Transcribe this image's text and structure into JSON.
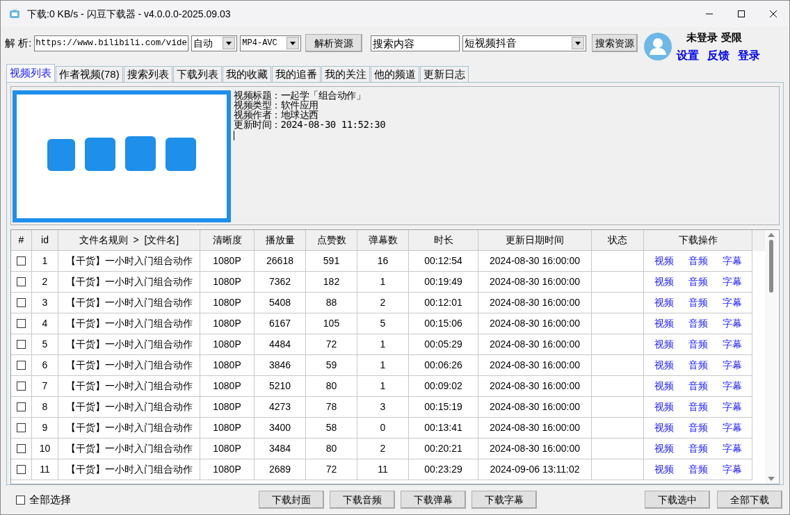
{
  "window": {
    "title": "下载:0 KB/s - 闪豆下载器 - v4.0.0.0-2025.09.03"
  },
  "toolbar": {
    "parse_label": "解 析:",
    "url": "https://www.bilibili.com/vide",
    "quality": "自动",
    "format": "MP4-AVC",
    "parse_button": "解析资源",
    "search_value": "搜索内容",
    "platform": "短视频抖音",
    "search_button": "搜索资源"
  },
  "account": {
    "status": "未登录 受限",
    "links": [
      "设置",
      "反馈",
      "登录"
    ]
  },
  "tabs": [
    {
      "label": "视频列表",
      "selected": true
    },
    {
      "label": "作者视频(78)",
      "selected": false
    },
    {
      "label": "搜索列表",
      "selected": false
    },
    {
      "label": "下载列表",
      "selected": false
    },
    {
      "label": "我的收藏",
      "selected": false
    },
    {
      "label": "我的追番",
      "selected": false
    },
    {
      "label": "我的关注",
      "selected": false
    },
    {
      "label": "他的频道",
      "selected": false
    },
    {
      "label": "更新日志",
      "selected": false
    }
  ],
  "info": {
    "lines": [
      "视频标题：一起学「组合动作」",
      "视频类型：软件应用",
      "视频作者：地球达西",
      "更新时间：2024-08-30 11:52:30"
    ]
  },
  "table": {
    "columns": [
      "#",
      "id",
      "文件名规则  >  [文件名]",
      "清晰度",
      "播放量",
      "点赞数",
      "弹幕数",
      "时长",
      "更新日期时间",
      "状态",
      "下载操作"
    ],
    "rows": [
      {
        "checked": false,
        "id": "1",
        "name": "【干货】一小时入门组合动作",
        "quality": "1080P",
        "plays": "26618",
        "likes": "591",
        "danmaku": "16",
        "duration": "00:12:54",
        "updated": "2024-08-30 16:00:00",
        "actions": [
          "视频",
          "音频",
          "字幕"
        ]
      },
      {
        "checked": false,
        "id": "2",
        "name": "【干货】一小时入门组合动作",
        "quality": "1080P",
        "plays": "7362",
        "likes": "182",
        "danmaku": "1",
        "duration": "00:19:49",
        "updated": "2024-08-30 16:00:00",
        "actions": [
          "视频",
          "音频",
          "字幕"
        ]
      },
      {
        "checked": false,
        "id": "3",
        "name": "【干货】一小时入门组合动作",
        "quality": "1080P",
        "plays": "5408",
        "likes": "88",
        "danmaku": "2",
        "duration": "00:12:01",
        "updated": "2024-08-30 16:00:00",
        "actions": [
          "视频",
          "音频",
          "字幕"
        ]
      },
      {
        "checked": false,
        "id": "4",
        "name": "【干货】一小时入门组合动作",
        "quality": "1080P",
        "plays": "6167",
        "likes": "105",
        "danmaku": "5",
        "duration": "00:15:06",
        "updated": "2024-08-30 16:00:00",
        "actions": [
          "视频",
          "音频",
          "字幕"
        ]
      },
      {
        "checked": false,
        "id": "5",
        "name": "【干货】一小时入门组合动作",
        "quality": "1080P",
        "plays": "4484",
        "likes": "72",
        "danmaku": "1",
        "duration": "00:05:29",
        "updated": "2024-08-30 16:00:00",
        "actions": [
          "视频",
          "音频",
          "字幕"
        ]
      },
      {
        "checked": false,
        "id": "6",
        "name": "【干货】一小时入门组合动作",
        "quality": "1080P",
        "plays": "3846",
        "likes": "59",
        "danmaku": "1",
        "duration": "00:06:26",
        "updated": "2024-08-30 16:00:00",
        "actions": [
          "视频",
          "音频",
          "字幕"
        ]
      },
      {
        "checked": false,
        "id": "7",
        "name": "【干货】一小时入门组合动作",
        "quality": "1080P",
        "plays": "5210",
        "likes": "80",
        "danmaku": "1",
        "duration": "00:09:02",
        "updated": "2024-08-30 16:00:00",
        "actions": [
          "视频",
          "音频",
          "字幕"
        ]
      },
      {
        "checked": false,
        "id": "8",
        "name": "【干货】一小时入门组合动作",
        "quality": "1080P",
        "plays": "4273",
        "likes": "78",
        "danmaku": "3",
        "duration": "00:15:19",
        "updated": "2024-08-30 16:00:00",
        "actions": [
          "视频",
          "音频",
          "字幕"
        ]
      },
      {
        "checked": false,
        "id": "9",
        "name": "【干货】一小时入门组合动作",
        "quality": "1080P",
        "plays": "3400",
        "likes": "58",
        "danmaku": "0",
        "duration": "00:13:41",
        "updated": "2024-08-30 16:00:00",
        "actions": [
          "视频",
          "音频",
          "字幕"
        ]
      },
      {
        "checked": false,
        "id": "10",
        "name": "【干货】一小时入门组合动作",
        "quality": "1080P",
        "plays": "3484",
        "likes": "80",
        "danmaku": "2",
        "duration": "00:20:21",
        "updated": "2024-08-30 16:00:00",
        "actions": [
          "视频",
          "音频",
          "字幕"
        ]
      },
      {
        "checked": false,
        "id": "11",
        "name": "【干货】一小时入门组合动作",
        "quality": "1080P",
        "plays": "2689",
        "likes": "72",
        "danmaku": "11",
        "duration": "00:23:29",
        "updated": "2024-09-06 13:11:02",
        "actions": [
          "视频",
          "音频",
          "字幕"
        ]
      }
    ]
  },
  "footer": {
    "select_all": {
      "label": "全部选择",
      "checked": false
    },
    "left_buttons": [
      "下载封面",
      "下载音频",
      "下载弹幕",
      "下载字幕"
    ],
    "right_buttons": [
      "下载选中",
      "全部下载"
    ]
  }
}
